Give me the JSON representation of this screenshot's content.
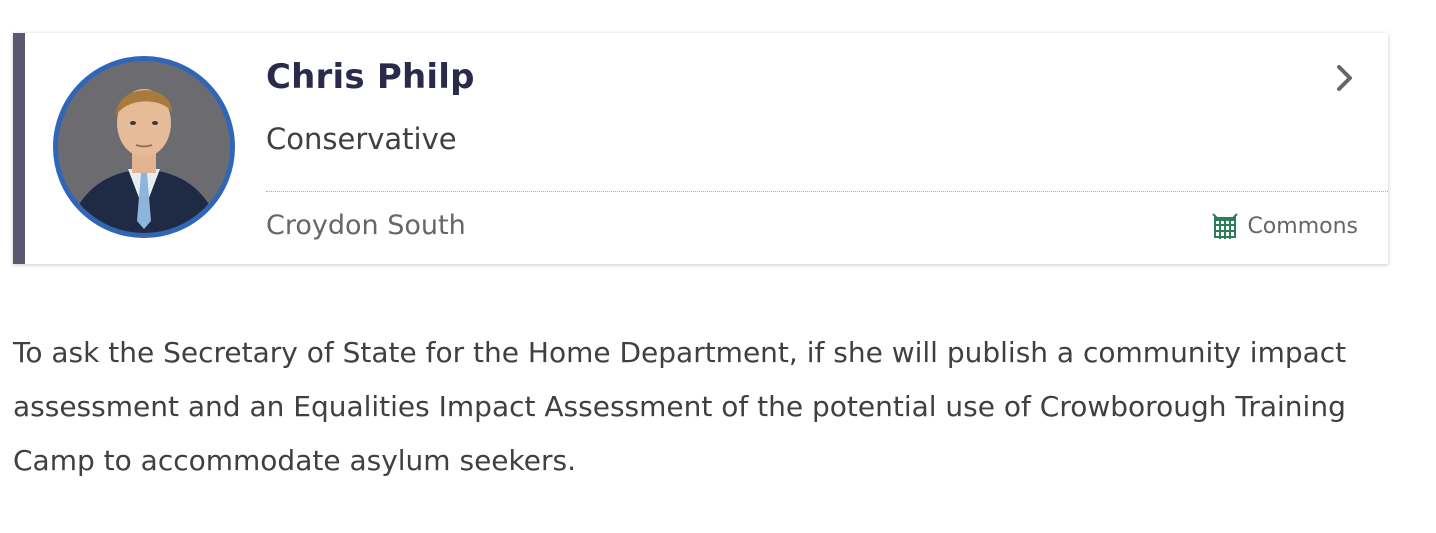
{
  "member": {
    "name": "Chris Philp",
    "party": "Conservative",
    "constituency": "Croydon South",
    "house": "Commons",
    "photo_icon": "member-portrait",
    "house_icon": "portcullis-icon",
    "colors": {
      "accent_bar": "#5b5770",
      "avatar_ring": "#2f66b8",
      "house_icon": "#2d7d5a"
    }
  },
  "question": {
    "text": "To ask the Secretary of State for the Home Department, if she will publish a community impact assessment and an Equalities Impact Assessment of the potential use of Crowborough Training Camp to accommodate asylum seekers."
  }
}
